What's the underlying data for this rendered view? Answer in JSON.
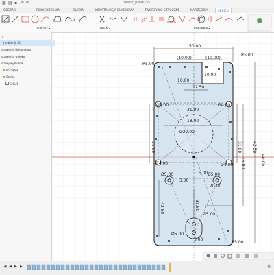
{
  "window": {
    "title": "talerz_płaski v5"
  },
  "tabs": [
    {
      "label": "OBSZAR"
    },
    {
      "label": "POWIERZCHNIA"
    },
    {
      "label": "SIATKA"
    },
    {
      "label": "KONSTRUKCJA BLACHOWA"
    },
    {
      "label": "TWORZYWO SZTUCZNE"
    },
    {
      "label": "NARZĘDZIA"
    },
    {
      "label": "SZKICU"
    }
  ],
  "toolbar": {
    "group_create": "UTWÓRZ ▾",
    "group_modify": "ZMIEŃ ▾",
    "group_constraints": "WIĄZANIA ▾"
  },
  "browser": {
    "items": [
      {
        "label": "ś"
      },
      {
        "label": "(untitled) v5"
      },
      {
        "label": "stawienia dokumentu"
      },
      {
        "label": "stawienia widoku"
      },
      {
        "label": "stawy wybiorów"
      },
      {
        "label": "Początek"
      },
      {
        "label": "Szkice"
      },
      {
        "label": "Szkic1"
      }
    ]
  },
  "drawing": {
    "dims": {
      "overall_width": "50.00",
      "top_10a": "(10.00)",
      "top_10b": "(10.00)",
      "slot_10": "10.00",
      "slot_10b": "10.00",
      "slot_1250": "12.50",
      "r5_top": "R5.00",
      "r5_tr": "R5.00",
      "r5_br": "R5.00",
      "phi4_tl": "Ø4.00",
      "phi4_tr": "Ø4.00",
      "phi4_bl": "Ø4.00",
      "phi4_br": "Ø4.00",
      "d31_top": "31.00",
      "d18": "18.00",
      "phi22": "Ø22.00",
      "d31_left": "31.00",
      "d31_right": "31.00",
      "d4250": "42.50",
      "d15": "15.00",
      "d40_vert": "40.00",
      "phi5_l": "Ø5.00",
      "phi5_r": "Ø5.00",
      "d3": "3.00",
      "d5": "5.00",
      "d3150": "31.50",
      "d4250_b": "42.50",
      "phi5_b1": "Ø5.00",
      "phi5_b2": "Ø5.00",
      "d20": "20.00",
      "d5_b": "5.00"
    }
  },
  "timeline": {
    "markers": [
      "|◀",
      "◀",
      "▶",
      "▶|"
    ]
  },
  "colors": {
    "accent": "#1e6fc2",
    "sketch_fill": "#c9dcec",
    "sketch_line": "#1a1a1a",
    "axis_red": "#d55b5b",
    "grid": "#e6e6e6"
  }
}
